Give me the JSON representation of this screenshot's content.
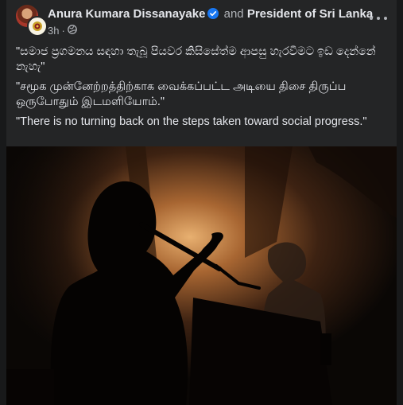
{
  "post": {
    "author": "Anura Kumara Dissanayake",
    "connector": "and",
    "coauthor": "President of Sri Lanka",
    "time": "3h",
    "privacy_icon": "globe-icon",
    "paragraphs": [
      "\"සමාජ ප්‍රගමනය සඳහා තැබූ පියවර කිසිසේත්ම ආපසු හැරවීමට ඉඩ දෙන්නේ නැහැ\"",
      "\"சமூக முன்னேற்றத்திற்காக வைக்கப்பட்ட அடியை திசை திருப்ப ஒருபோதும் இடமளியோம்.\"",
      "\"There is no turning back on the steps taken toward social progress.\""
    ]
  },
  "colors": {
    "card_bg": "#242526",
    "page_bg": "#18191a",
    "verified": "#1877f2",
    "text_primary": "#e4e6eb",
    "text_secondary": "#b0b3b8"
  }
}
